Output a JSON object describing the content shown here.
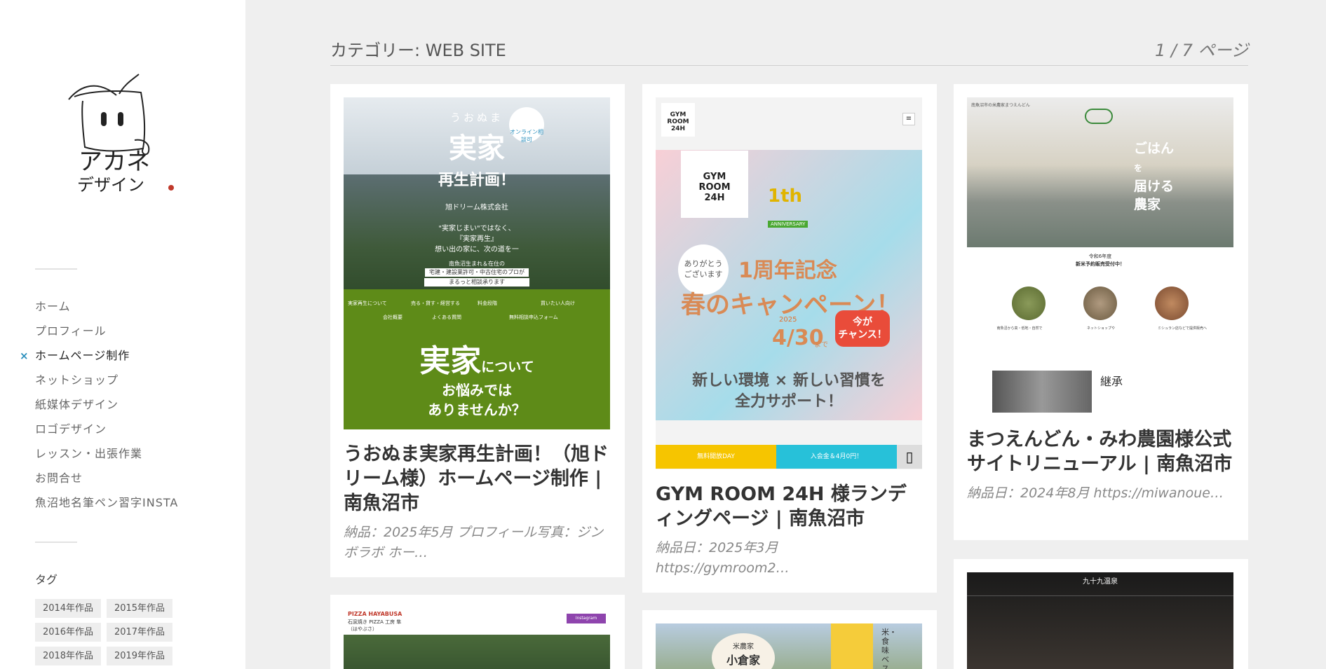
{
  "sidebar": {
    "logo": {
      "line1": "アカネ",
      "line2": "デザイン"
    },
    "nav": [
      {
        "label": "ホーム"
      },
      {
        "label": "プロフィール"
      },
      {
        "label": "ホームページ制作",
        "active": true,
        "mark": "×"
      },
      {
        "label": "ネットショップ"
      },
      {
        "label": "紙媒体デザイン"
      },
      {
        "label": "ロゴデザイン"
      },
      {
        "label": "レッスン・出張作業"
      },
      {
        "label": "お問合せ"
      },
      {
        "label": "魚沼地名筆ペン習字INSTA"
      }
    ],
    "tags_title": "タグ",
    "tags": [
      "2014年作品",
      "2015年作品",
      "2016年作品",
      "2017年作品",
      "2018年作品",
      "2019年作品"
    ]
  },
  "header": {
    "title": "カテゴリー: WEB SITE",
    "pager": "1 / 7 ページ"
  },
  "cards": [
    {
      "title": "うおぬま実家再生計画！（旭ドリーム様）ホームページ制作 | 南魚沼市",
      "excerpt": "納品：2025年5月 プロフィール写真：ジンボラボ ホー…",
      "thumb": {
        "kicker": "うおぬま",
        "hero1": "実家",
        "hero2": "再生計画！",
        "badge": "オンライン相談可",
        "company": "旭ドリーム株式会社",
        "lines": [
          "\"実家じまい\"ではなく、",
          "『実家再生』",
          "想い出の家に、次の道を一"
        ],
        "info1": "南魚沼生まれ＆在住の",
        "info2": "宅建・建設業許可・中古住宅のプロが",
        "info3": "まるっと相談承ります",
        "menu": [
          "実家再生について",
          "売る・貸す・経営する",
          "料金段階",
          "買いたい人向け",
          "会社概要",
          "よくある質問",
          "無料相談申込フォーム"
        ],
        "big": "実家",
        "big_small": "について",
        "q1": "お悩みでは",
        "q2": "ありませんか？"
      }
    },
    {
      "title": "GYM ROOM 24H 様ランディングページ | 南魚沼市",
      "excerpt1": "納品日：2025年3月",
      "excerpt2": "https://gymroom2…",
      "thumb": {
        "logo": [
          "GYM",
          "ROOM",
          "24H"
        ],
        "anniv": "1th",
        "anniv_tag": "ANNIVERSARY",
        "thanks": [
          "ありがとう",
          "ございます"
        ],
        "headline": "1周年記念",
        "campaign": "春のキャンペーン！",
        "date_year": "2025",
        "date": "4/30",
        "date_suffix": "まで",
        "chance": [
          "今が",
          "チャンス！"
        ],
        "tag1": "新しい環境 × 新しい習慣を",
        "tag2": "全力サポート！",
        "btn_yellow": "無料開放DAY",
        "btn_blue": "入会金＆4月0円！"
      }
    },
    {
      "title": "まつえんどん・みわ農園様公式サイトリニューアル | 南魚沼市",
      "excerpt": "納品日：2024年8月 https://miwanoue…",
      "thumb": {
        "header": "南魚沼市の米農家まつえんどん",
        "hero": [
          "ごはん",
          "を",
          "届ける",
          "農家"
        ],
        "notice1": "令和6年度",
        "notice2": "新米予約販売受付中！",
        "items": [
          "南魚沼から高・低地・自然で",
          "ネットショップや",
          "ミシュラン店などで提供販売へ"
        ],
        "section": "継承"
      }
    },
    {
      "thumb": {
        "name": "PIZZA HAYABUSA",
        "sub": "石窯焼き PIZZA 工房 隼",
        "sub2": "（はやぶさ）",
        "btn": "Instagram"
      }
    },
    {
      "thumb": {
        "label": "米農家",
        "name": "小倉家",
        "side": "米・食味ベスト"
      }
    },
    {
      "thumb": {
        "name": "九十九温泉"
      }
    }
  ],
  "colors": {
    "accent": "#2a8fbd",
    "green": "#5e8b18",
    "gym_pink": "#f8cfd6",
    "gym_blue": "#a6dcea"
  }
}
